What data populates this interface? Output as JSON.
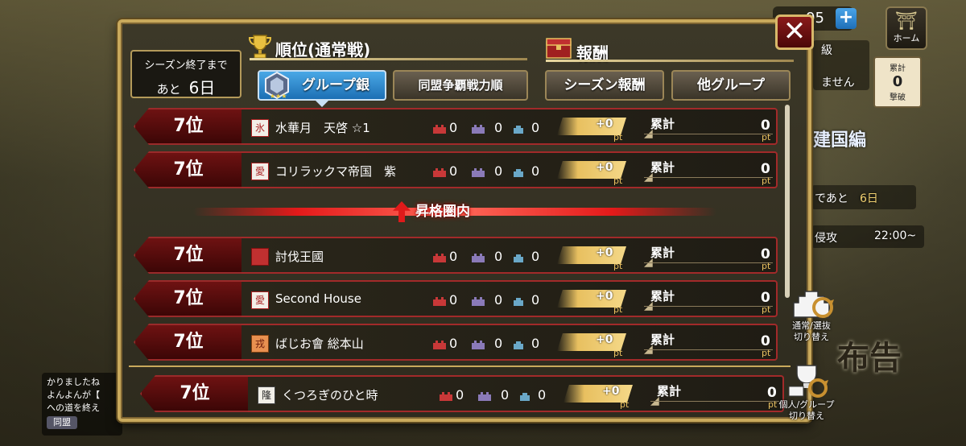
{
  "hud": {
    "currency_value": "95",
    "plus_label": "+",
    "home_label": "ホーム"
  },
  "background": {
    "level_text": "級",
    "no_text": "ません",
    "card_label": "累計",
    "card_count": "0",
    "card_unit": "撃破",
    "event_title": "建国編",
    "remaining_label": "であと",
    "remaining_days": "6日",
    "attack_label": "侵攻",
    "attack_time": "22:00~",
    "announce": "布告",
    "chat_line1": "かりましたね",
    "chat_line2": "よんよんが【",
    "chat_line3": "への道を終え",
    "chat_tag": "同盟"
  },
  "season": {
    "line1": "シーズン終了まで",
    "remaining_prefix": "あと",
    "remaining_days": "6日"
  },
  "sections": {
    "ranking_title": "順位(通常戦)",
    "reward_title": "報酬"
  },
  "tabs": [
    {
      "label": "グループ銀",
      "active": true
    },
    {
      "label": "同盟争覇戦力順",
      "active": false
    },
    {
      "label": "シーズン報酬",
      "active": false
    },
    {
      "label": "他グループ",
      "active": false
    }
  ],
  "rows": [
    {
      "rank": "7位",
      "flag": "氷",
      "name": "水華月　天啓 ☆1",
      "s1": "0",
      "s2": "0",
      "s3": "0",
      "pt": "+0",
      "pt_unit": "pt",
      "total_label": "累計",
      "total": "0",
      "total_unit": "pt"
    },
    {
      "rank": "7位",
      "flag": "愛",
      "name": "コリラックマ帝国　紫",
      "s1": "0",
      "s2": "0",
      "s3": "0",
      "pt": "+0",
      "pt_unit": "pt",
      "total_label": "累計",
      "total": "0",
      "total_unit": "pt"
    },
    {
      "rank": "7位",
      "flag": "",
      "name": "討伐王國",
      "s1": "0",
      "s2": "0",
      "s3": "0",
      "pt": "+0",
      "pt_unit": "pt",
      "total_label": "累計",
      "total": "0",
      "total_unit": "pt"
    },
    {
      "rank": "7位",
      "flag": "愛",
      "name": "Second House",
      "s1": "0",
      "s2": "0",
      "s3": "0",
      "pt": "+0",
      "pt_unit": "pt",
      "total_label": "累計",
      "total": "0",
      "total_unit": "pt"
    },
    {
      "rank": "7位",
      "flag": "戎",
      "name": "ばじお會 総本山",
      "s1": "0",
      "s2": "0",
      "s3": "0",
      "pt": "+0",
      "pt_unit": "pt",
      "total_label": "累計",
      "total": "0",
      "total_unit": "pt"
    }
  ],
  "promotion_label": "昇格圏内",
  "self_row": {
    "rank": "7位",
    "flag": "隆",
    "name": "くつろぎのひと時",
    "s1": "0",
    "s2": "0",
    "s3": "0",
    "pt": "+0",
    "pt_unit": "pt",
    "total_label": "累計",
    "total": "0",
    "total_unit": "pt"
  },
  "switches": {
    "mode_line1": "通常/選抜",
    "mode_line2": "切り替え",
    "scope_line1": "個人/グループ",
    "scope_line2": "切り替え"
  },
  "close_label": "✕"
}
